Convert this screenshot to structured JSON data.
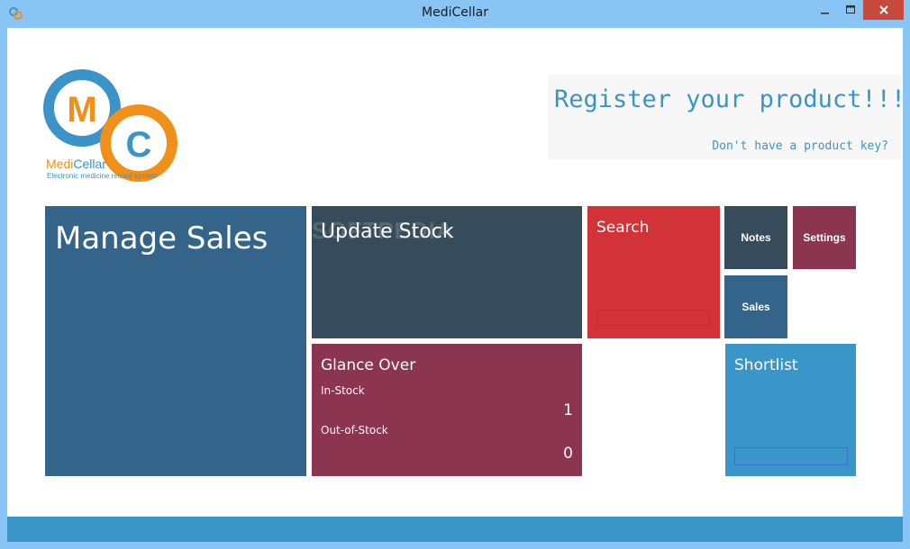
{
  "window": {
    "title": "MediCellar",
    "app_icon": "medicellar-app-icon",
    "controls": [
      "minimize-icon",
      "maximize-icon",
      "close-icon"
    ]
  },
  "logo": {
    "letter_m": "M",
    "letter_c": "C",
    "name_part1": "Medi",
    "name_part2": "Cellar",
    "tagline": "Electronic medicine record system"
  },
  "register": {
    "title": "Register your product!!!",
    "link": "Don't have a product key?"
  },
  "tiles": {
    "manage_sales": "Manage Sales",
    "update_stock": "Update Stock",
    "search": "Search",
    "notes": "Notes",
    "settings": "Settings",
    "sales": "Sales",
    "glance_over": {
      "title": "Glance Over",
      "in_stock_label": "In-Stock",
      "in_stock_value": "1",
      "out_of_stock_label": "Out-of-Stock",
      "out_of_stock_value": "0"
    },
    "shortlist": "Shortlist"
  },
  "watermark": "SOFTPEDIA",
  "colors": {
    "titlebar": "#88c4f4",
    "manage_sales": "#346489",
    "update_stock": "#364c5a",
    "search": "#d13338",
    "settings": "#8b3551",
    "glance_over": "#8b3551",
    "shortlist": "#3a96c9",
    "logo_orange": "#f18f1b",
    "logo_blue": "#3b94c8"
  }
}
